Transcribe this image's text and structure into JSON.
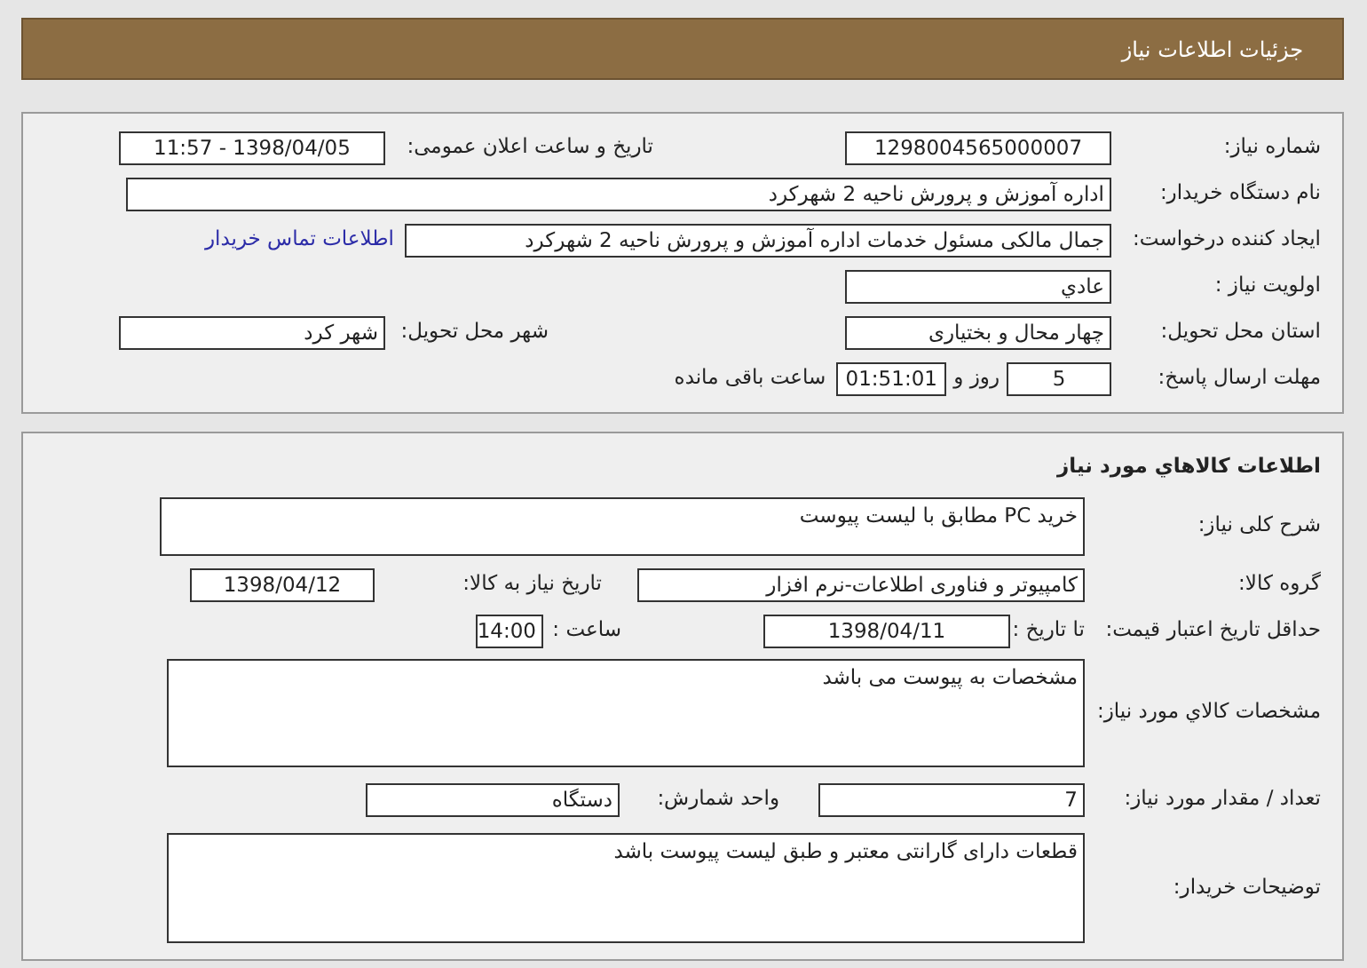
{
  "header": {
    "title": "جزئیات اطلاعات نیاز"
  },
  "need_info": {
    "need_number": {
      "label": "شماره نیاز:",
      "value": "1298004565000007"
    },
    "announce_datetime": {
      "label": "تاریخ و ساعت اعلان عمومی:",
      "value": "1398/04/05 - 11:57"
    },
    "buyer_org": {
      "label": "نام دستگاه خریدار:",
      "value": "اداره آموزش و پرورش ناحیه 2 شهرکرد"
    },
    "requester": {
      "label": "ایجاد کننده درخواست:",
      "value": "جمال مالکی مسئول خدمات اداره آموزش و پرورش ناحیه 2 شهرکرد"
    },
    "contact_link": {
      "text": "اطلاعات تماس خریدار"
    },
    "priority": {
      "label": "اولویت نیاز :",
      "value": "عادي"
    },
    "province": {
      "label": "استان محل تحویل:",
      "value": "چهار محال و بختیاری"
    },
    "city": {
      "label": "شهر محل تحویل:",
      "value": "شهر کرد"
    },
    "deadline": {
      "label": "مهلت ارسال پاسخ:",
      "days": "5",
      "days_suffix": "روز و",
      "time": "01:51:01",
      "time_suffix": "ساعت باقی مانده"
    }
  },
  "goods": {
    "title": "اطلاعات کالاهاي مورد نياز",
    "description": {
      "label": "شرح کلی نیاز:",
      "value": "خرید PC مطابق با لیست پیوست"
    },
    "group": {
      "label": "گروه کالا:",
      "value": "کامپیوتر و فناوری اطلاعات-نرم افزار"
    },
    "need_date": {
      "label": "تاریخ نیاز به کالا:",
      "value": "1398/04/12"
    },
    "price_validity": {
      "label": "حداقل تاریخ اعتبار قیمت:",
      "date_label": "تا تاریخ :",
      "date": "1398/04/11",
      "time_label": "ساعت :",
      "time": "14:00"
    },
    "specs": {
      "label": "مشخصات کالاي مورد نياز:",
      "value": "مشخصات به پیوست می باشد"
    },
    "quantity": {
      "label": "تعداد / مقدار مورد نیاز:",
      "value": "7"
    },
    "unit": {
      "label": "واحد شمارش:",
      "value": "دستگاه"
    },
    "buyer_notes": {
      "label": "توضیحات خریدار:",
      "value": "قطعات دارای گارانتی معتبر و طبق لیست پیوست باشد"
    }
  }
}
